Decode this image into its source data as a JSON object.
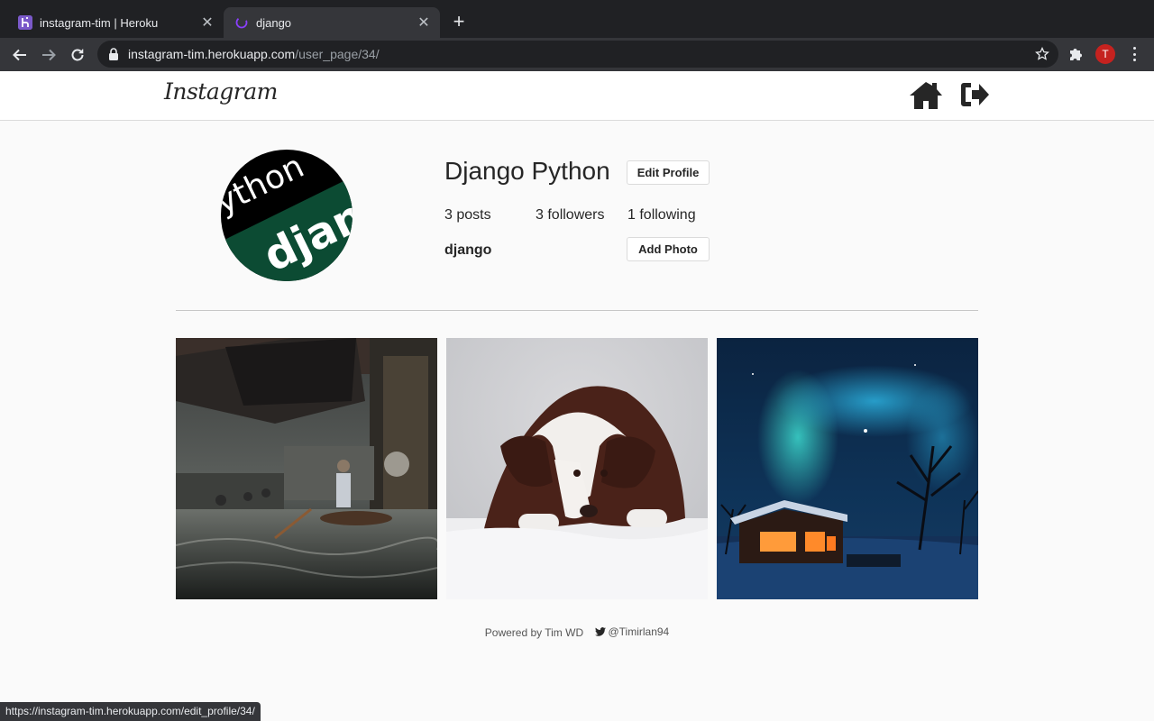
{
  "browser": {
    "tabs": [
      {
        "title": "instagram-tim | Heroku",
        "icon": "heroku-favicon"
      },
      {
        "title": "django",
        "icon": "django-favicon"
      }
    ],
    "new_tab_label": "+",
    "url_host": "instagram-tim.herokuapp.com",
    "url_path": "/user_page/34/",
    "profile_initial": "T",
    "status_url": "https://instagram-tim.herokuapp.com/edit_profile/34/"
  },
  "header": {
    "logo": "Instagram",
    "home_icon": "home-icon",
    "logout_icon": "logout-icon"
  },
  "profile": {
    "name": "Django Python",
    "edit_label": "Edit Profile",
    "posts": "3 posts",
    "followers": "3 followers",
    "following": "1 following",
    "username": "django",
    "add_photo_label": "Add Photo",
    "avatar_text_top": "ython",
    "avatar_text_bottom": "djang"
  },
  "photos": [
    {
      "subject": "floating-market-photo"
    },
    {
      "subject": "dog-in-snow-photo"
    },
    {
      "subject": "aurora-cabin-photo"
    }
  ],
  "footer": {
    "powered": "Powered by Tim WD",
    "twitter": "@Timirlan94"
  },
  "colors": {
    "chrome_dark": "#202124",
    "chrome_mid": "#35363a",
    "django_green": "#0c4b33",
    "profile_red": "#c5221f"
  }
}
